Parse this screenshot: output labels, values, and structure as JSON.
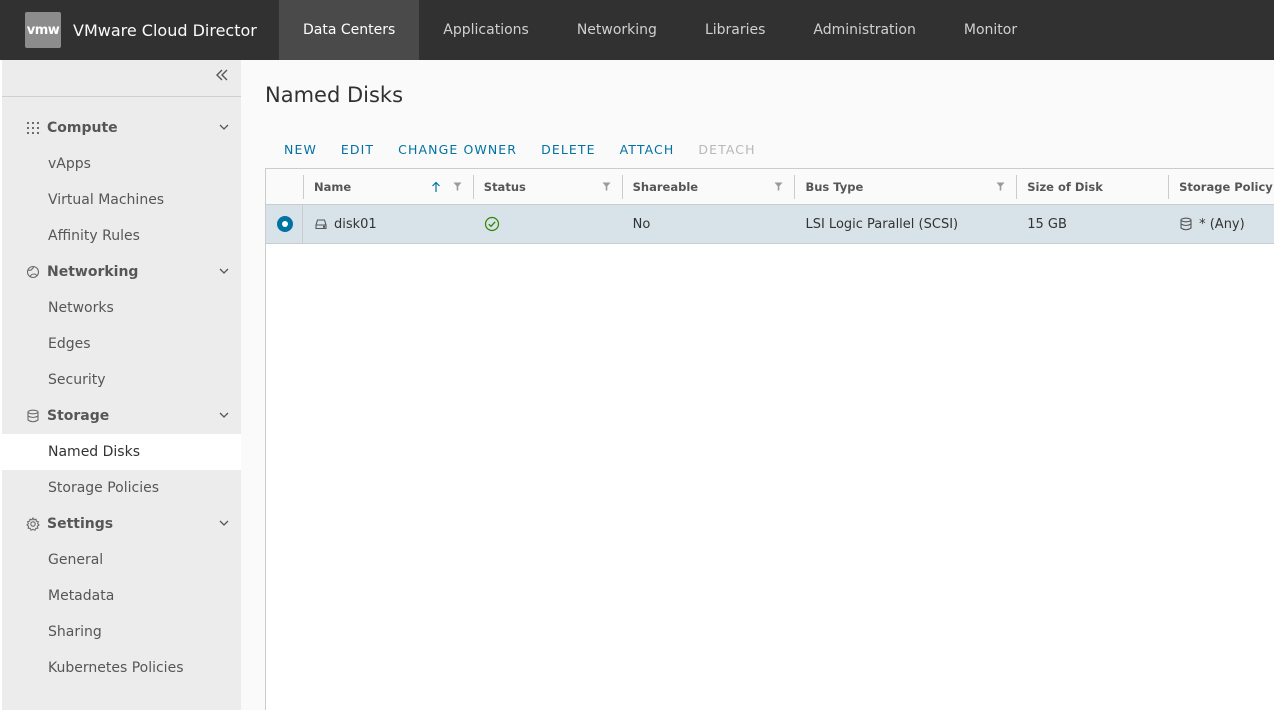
{
  "header": {
    "logo_text": "vmw",
    "app_title": "VMware Cloud Director",
    "nav": [
      {
        "label": "Data Centers",
        "active": true
      },
      {
        "label": "Applications"
      },
      {
        "label": "Networking"
      },
      {
        "label": "Libraries"
      },
      {
        "label": "Administration"
      },
      {
        "label": "Monitor"
      }
    ]
  },
  "sidebar": {
    "groups": [
      {
        "label": "Compute",
        "icon": "grid-dots-icon",
        "items": [
          "vApps",
          "Virtual Machines",
          "Affinity Rules"
        ]
      },
      {
        "label": "Networking",
        "icon": "globe-icon",
        "items": [
          "Networks",
          "Edges",
          "Security"
        ]
      },
      {
        "label": "Storage",
        "icon": "database-icon",
        "items": [
          "Named Disks",
          "Storage Policies"
        ]
      },
      {
        "label": "Settings",
        "icon": "gear-icon",
        "items": [
          "General",
          "Metadata",
          "Sharing",
          "Kubernetes Policies"
        ]
      }
    ],
    "active_item": "Named Disks"
  },
  "main": {
    "title": "Named Disks",
    "actions": [
      {
        "label": "NEW",
        "enabled": true
      },
      {
        "label": "EDIT",
        "enabled": true
      },
      {
        "label": "CHANGE OWNER",
        "enabled": true
      },
      {
        "label": "DELETE",
        "enabled": true
      },
      {
        "label": "ATTACH",
        "enabled": true
      },
      {
        "label": "DETACH",
        "enabled": false
      }
    ],
    "grid": {
      "columns": [
        "Name",
        "Status",
        "Shareable",
        "Bus Type",
        "Size of Disk",
        "Storage Policy"
      ],
      "rows": [
        {
          "name": "disk01",
          "status": "ok",
          "shareable": "No",
          "bus_type": "LSI Logic Parallel (SCSI)",
          "size": "15 GB",
          "storage_policy": "* (Any)"
        }
      ]
    }
  },
  "colors": {
    "header_bg": "#313131",
    "accent": "#0072a3",
    "status_ok": "#2f8400",
    "selected_row": "#d8e3e9"
  }
}
